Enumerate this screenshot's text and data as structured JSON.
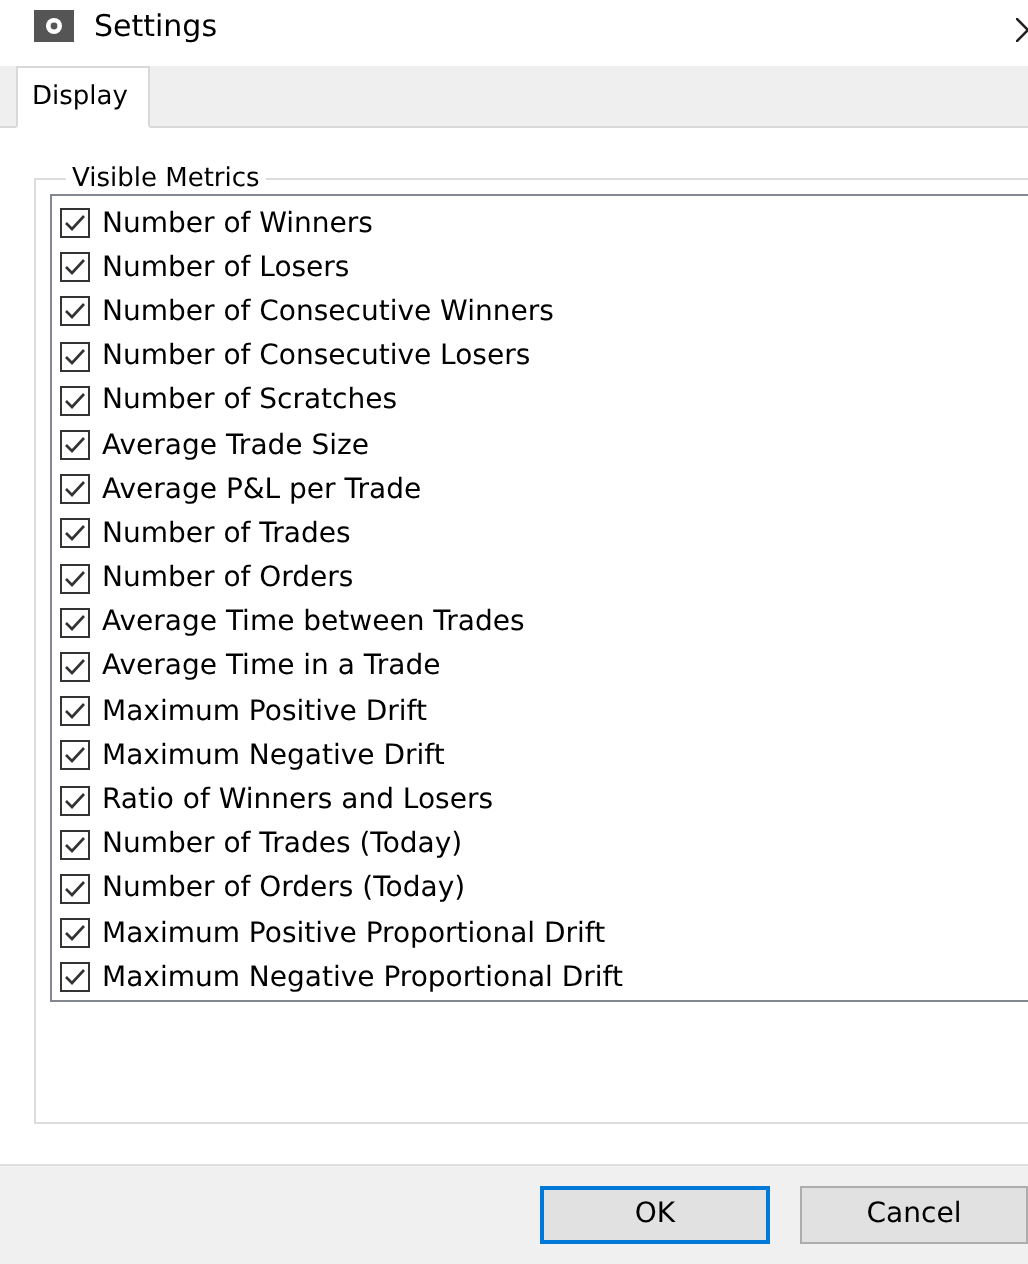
{
  "window": {
    "title": "Settings"
  },
  "tabs": [
    {
      "label": "Display",
      "selected": true
    }
  ],
  "group": {
    "title": "Visible Metrics"
  },
  "metrics": [
    {
      "label": "Number of Winners",
      "checked": true
    },
    {
      "label": "Number of Losers",
      "checked": true
    },
    {
      "label": "Number of Consecutive Winners",
      "checked": true
    },
    {
      "label": "Number of Consecutive Losers",
      "checked": true
    },
    {
      "label": "Number of Scratches",
      "checked": true
    },
    {
      "label": "Average Trade Size",
      "checked": true
    },
    {
      "label": "Average P&L per Trade",
      "checked": true
    },
    {
      "label": "Number of Trades",
      "checked": true
    },
    {
      "label": "Number of Orders",
      "checked": true
    },
    {
      "label": "Average Time between Trades",
      "checked": true
    },
    {
      "label": "Average Time in a Trade",
      "checked": true
    },
    {
      "label": "Maximum Positive Drift",
      "checked": true
    },
    {
      "label": "Maximum Negative Drift",
      "checked": true
    },
    {
      "label": "Ratio of Winners and Losers",
      "checked": true
    },
    {
      "label": "Number of Trades (Today)",
      "checked": true
    },
    {
      "label": "Number of Orders (Today)",
      "checked": true
    },
    {
      "label": "Maximum Positive Proportional Drift",
      "checked": true
    },
    {
      "label": "Maximum Negative Proportional Drift",
      "checked": true
    }
  ],
  "buttons": [
    {
      "label": "OK",
      "kind": "default"
    },
    {
      "label": "Cancel",
      "kind": "normal"
    }
  ]
}
